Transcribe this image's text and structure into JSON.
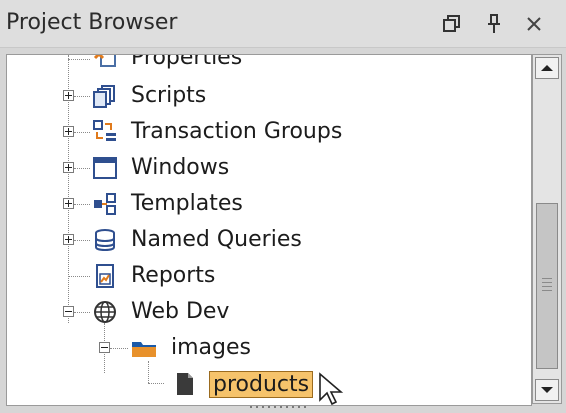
{
  "panel": {
    "title": "Project Browser",
    "buttons": [
      "restore-icon",
      "pin-icon",
      "close-icon"
    ]
  },
  "tree": {
    "items": [
      {
        "label": "Properties",
        "icon": "properties-icon",
        "expander": "none"
      },
      {
        "label": "Scripts",
        "icon": "scripts-icon",
        "expander": "plus"
      },
      {
        "label": "Transaction Groups",
        "icon": "transaction-groups-icon",
        "expander": "plus"
      },
      {
        "label": "Windows",
        "icon": "windows-icon",
        "expander": "plus"
      },
      {
        "label": "Templates",
        "icon": "templates-icon",
        "expander": "plus"
      },
      {
        "label": "Named Queries",
        "icon": "named-queries-icon",
        "expander": "plus"
      },
      {
        "label": "Reports",
        "icon": "reports-icon",
        "expander": "none"
      },
      {
        "label": "Web Dev",
        "icon": "globe-icon",
        "expander": "minus"
      },
      {
        "label": "images",
        "icon": "folder-icon",
        "expander": "minus"
      },
      {
        "label": "products",
        "icon": "file-icon",
        "expander": "none",
        "selected": true
      }
    ]
  },
  "colors": {
    "selection": "#f6c36b",
    "background": "#ffffff",
    "panel": "#d6d6d6"
  }
}
